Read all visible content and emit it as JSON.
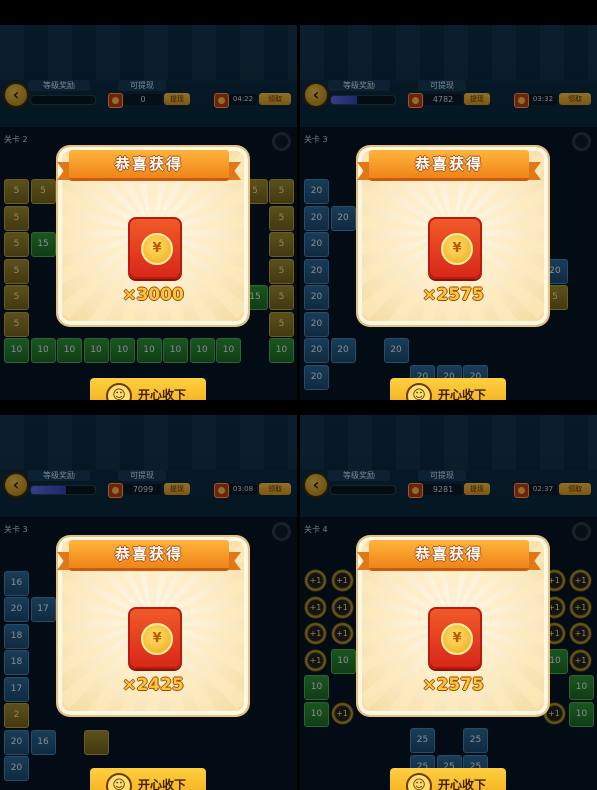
{
  "panels": [
    {
      "header": {
        "level_label": "等级奖励",
        "level_progress": 0.0,
        "cash_label": "可提现",
        "cash_value": "0",
        "cash_button": "提现",
        "timer": "04:22",
        "timer_button": "领取"
      },
      "stage": "关卡 2",
      "modal": {
        "title": "恭喜获得",
        "amount": "×3000"
      },
      "collect_label": "开心收下",
      "tiles": [
        {
          "t": "gold",
          "v": "5",
          "c": 0,
          "r": 0
        },
        {
          "t": "gold",
          "v": "5",
          "c": 1,
          "r": 0
        },
        {
          "t": "gold",
          "v": "5",
          "c": 9,
          "r": 0
        },
        {
          "t": "gold",
          "v": "5",
          "c": 10,
          "r": 0
        },
        {
          "t": "gold",
          "v": "5",
          "c": 0,
          "r": 1
        },
        {
          "t": "gold",
          "v": "5",
          "c": 10,
          "r": 1
        },
        {
          "t": "gold",
          "v": "5",
          "c": 0,
          "r": 2
        },
        {
          "t": "green",
          "v": "15",
          "c": 1,
          "r": 2
        },
        {
          "t": "gold",
          "v": "5",
          "c": 10,
          "r": 2
        },
        {
          "t": "gold",
          "v": "5",
          "c": 0,
          "r": 3
        },
        {
          "t": "gold",
          "v": "5",
          "c": 10,
          "r": 3
        },
        {
          "t": "gold",
          "v": "5",
          "c": 0,
          "r": 4
        },
        {
          "t": "green",
          "v": "15",
          "c": 9,
          "r": 4
        },
        {
          "t": "gold",
          "v": "5",
          "c": 10,
          "r": 4
        },
        {
          "t": "gold",
          "v": "5",
          "c": 0,
          "r": 5
        },
        {
          "t": "gold",
          "v": "5",
          "c": 10,
          "r": 5
        },
        {
          "t": "green",
          "v": "10",
          "c": 0,
          "r": 6
        },
        {
          "t": "green",
          "v": "10",
          "c": 1,
          "r": 6
        },
        {
          "t": "green",
          "v": "10",
          "c": 2,
          "r": 6
        },
        {
          "t": "green",
          "v": "10",
          "c": 3,
          "r": 6
        },
        {
          "t": "green",
          "v": "10",
          "c": 4,
          "r": 6
        },
        {
          "t": "green",
          "v": "10",
          "c": 5,
          "r": 6
        },
        {
          "t": "green",
          "v": "10",
          "c": 6,
          "r": 6
        },
        {
          "t": "green",
          "v": "10",
          "c": 7,
          "r": 6
        },
        {
          "t": "green",
          "v": "10",
          "c": 8,
          "r": 6
        },
        {
          "t": "green",
          "v": "10",
          "c": 10,
          "r": 6
        }
      ]
    },
    {
      "header": {
        "level_label": "等级奖励",
        "level_progress": 0.4,
        "cash_label": "可提现",
        "cash_value": "4782",
        "cash_button": "提现",
        "timer": "03:32",
        "timer_button": "领取"
      },
      "stage": "关卡 3",
      "modal": {
        "title": "恭喜获得",
        "amount": "×2575"
      },
      "collect_label": "开心收下",
      "tiles": [
        {
          "t": "blue",
          "v": "20",
          "c": 0,
          "r": 0
        },
        {
          "t": "blue",
          "v": "20",
          "c": 0,
          "r": 1
        },
        {
          "t": "blue",
          "v": "20",
          "c": 1,
          "r": 1
        },
        {
          "t": "blue",
          "v": "20",
          "c": 0,
          "r": 2
        },
        {
          "t": "blue",
          "v": "20",
          "c": 0,
          "r": 3
        },
        {
          "t": "blue",
          "v": "20",
          "c": 9,
          "r": 3
        },
        {
          "t": "blue",
          "v": "20",
          "c": 0,
          "r": 4
        },
        {
          "t": "gold",
          "v": "5",
          "c": 9,
          "r": 4
        },
        {
          "t": "blue",
          "v": "20",
          "c": 0,
          "r": 5
        },
        {
          "t": "blue",
          "v": "20",
          "c": 0,
          "r": 6
        },
        {
          "t": "blue",
          "v": "20",
          "c": 1,
          "r": 6
        },
        {
          "t": "blue",
          "v": "20",
          "c": 3,
          "r": 6
        },
        {
          "t": "blue",
          "v": "20",
          "c": 0,
          "r": 7
        },
        {
          "t": "blue",
          "v": "20",
          "c": 4,
          "r": 7
        },
        {
          "t": "blue",
          "v": "20",
          "c": 5,
          "r": 7
        },
        {
          "t": "blue",
          "v": "20",
          "c": 6,
          "r": 7
        }
      ]
    },
    {
      "header": {
        "level_label": "等级奖励",
        "level_progress": 0.55,
        "cash_label": "可提现",
        "cash_value": "7099",
        "cash_button": "提现",
        "timer": "03:08",
        "timer_button": "领取"
      },
      "stage": "关卡 3",
      "modal": {
        "title": "恭喜获得",
        "amount": "×2425"
      },
      "collect_label": "开心收下",
      "tiles": [
        {
          "t": "blue",
          "v": "16",
          "c": 0,
          "r": 1
        },
        {
          "t": "blue",
          "v": "20",
          "c": 0,
          "r": 2
        },
        {
          "t": "blue",
          "v": "17",
          "c": 1,
          "r": 2
        },
        {
          "t": "blue",
          "v": "18",
          "c": 0,
          "r": 3
        },
        {
          "t": "blue",
          "v": "18",
          "c": 0,
          "r": 4
        },
        {
          "t": "blue",
          "v": "17",
          "c": 0,
          "r": 5
        },
        {
          "t": "gold",
          "v": "2",
          "c": 0,
          "r": 6
        },
        {
          "t": "blue",
          "v": "20",
          "c": 0,
          "r": 7
        },
        {
          "t": "blue",
          "v": "16",
          "c": 1,
          "r": 7
        },
        {
          "t": "gold",
          "v": "",
          "c": 3,
          "r": 7
        },
        {
          "t": "blue",
          "v": "20",
          "c": 0,
          "r": 8
        }
      ]
    },
    {
      "header": {
        "level_label": "等级奖励",
        "level_progress": 0.0,
        "cash_label": "可提现",
        "cash_value": "9281",
        "cash_button": "提现",
        "timer": "02:37",
        "timer_button": "领取"
      },
      "stage": "关卡 4",
      "modal": {
        "title": "恭喜获得",
        "amount": "×2575"
      },
      "collect_label": "开心收下",
      "tiles": [
        {
          "t": "coin",
          "v": "+1",
          "c": 0,
          "r": 0
        },
        {
          "t": "coin",
          "v": "+1",
          "c": 1,
          "r": 0
        },
        {
          "t": "coin",
          "v": "+1",
          "c": 9,
          "r": 0
        },
        {
          "t": "coin",
          "v": "+1",
          "c": 10,
          "r": 0
        },
        {
          "t": "coin",
          "v": "+1",
          "c": 0,
          "r": 1
        },
        {
          "t": "coin",
          "v": "+1",
          "c": 1,
          "r": 1
        },
        {
          "t": "coin",
          "v": "+1",
          "c": 9,
          "r": 1
        },
        {
          "t": "coin",
          "v": "+1",
          "c": 10,
          "r": 1
        },
        {
          "t": "coin",
          "v": "+1",
          "c": 0,
          "r": 2
        },
        {
          "t": "coin",
          "v": "+1",
          "c": 1,
          "r": 2
        },
        {
          "t": "coin",
          "v": "+1",
          "c": 9,
          "r": 2
        },
        {
          "t": "coin",
          "v": "+1",
          "c": 10,
          "r": 2
        },
        {
          "t": "coin",
          "v": "+1",
          "c": 0,
          "r": 3
        },
        {
          "t": "green",
          "v": "10",
          "c": 1,
          "r": 3
        },
        {
          "t": "green",
          "v": "10",
          "c": 9,
          "r": 3
        },
        {
          "t": "coin",
          "v": "+1",
          "c": 10,
          "r": 3
        },
        {
          "t": "green",
          "v": "10",
          "c": 0,
          "r": 4
        },
        {
          "t": "green",
          "v": "10",
          "c": 10,
          "r": 4
        },
        {
          "t": "green",
          "v": "10",
          "c": 0,
          "r": 5
        },
        {
          "t": "coin",
          "v": "+1",
          "c": 1,
          "r": 5
        },
        {
          "t": "coin",
          "v": "+1",
          "c": 9,
          "r": 5
        },
        {
          "t": "green",
          "v": "10",
          "c": 10,
          "r": 5
        },
        {
          "t": "blue",
          "v": "25",
          "c": 4,
          "r": 6
        },
        {
          "t": "blue",
          "v": "25",
          "c": 6,
          "r": 6
        },
        {
          "t": "blue",
          "v": "25",
          "c": 4,
          "r": 7
        },
        {
          "t": "blue",
          "v": "25",
          "c": 5,
          "r": 7
        },
        {
          "t": "blue",
          "v": "25",
          "c": 6,
          "r": 7
        }
      ]
    }
  ]
}
